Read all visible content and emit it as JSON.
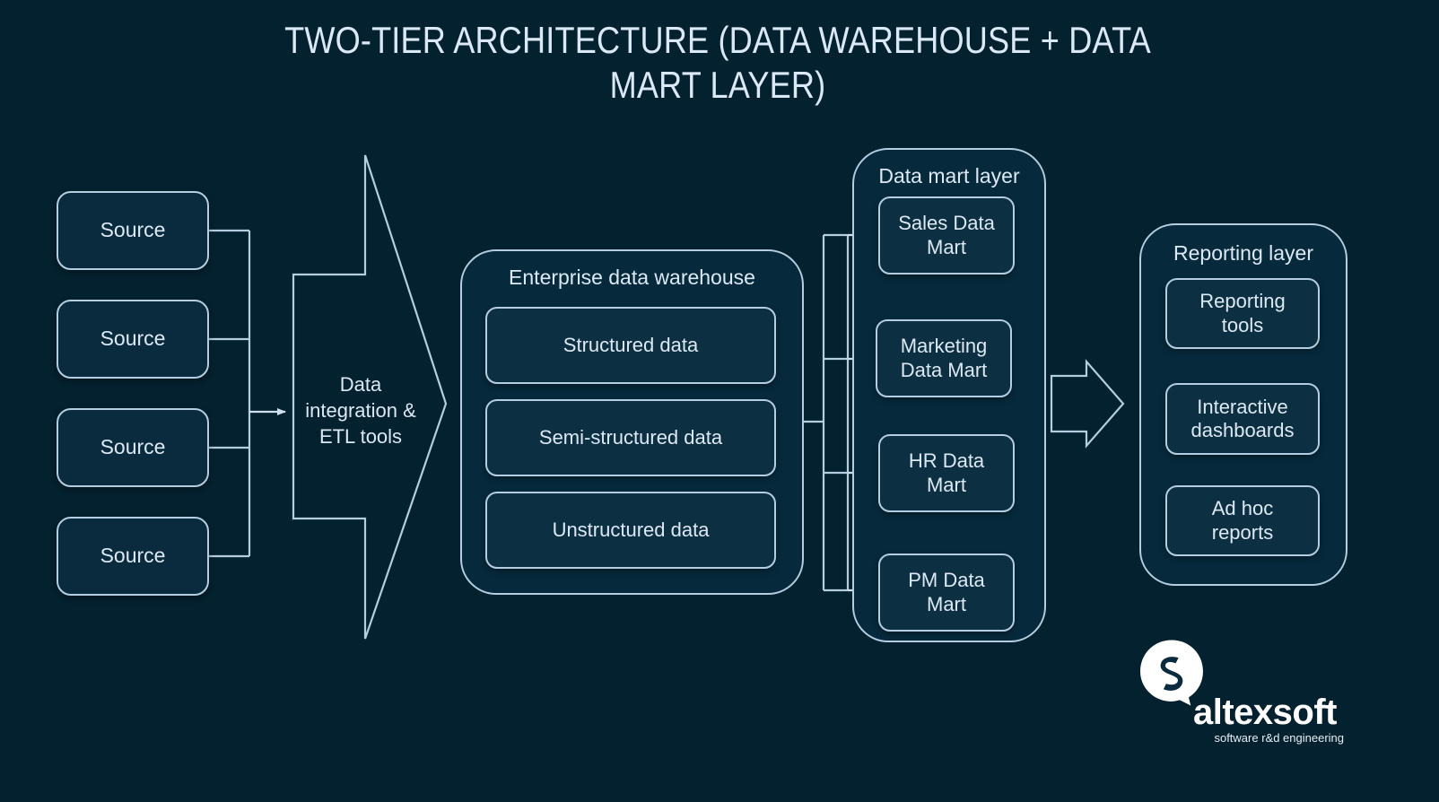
{
  "title": "TWO-TIER ARCHITECTURE (DATA WAREHOUSE + DATA MART LAYER)",
  "colors": {
    "background": "#04212f",
    "box_fill": "#0a2b3d",
    "inner_box_fill": "#0d2f42",
    "container_fill": "#062a3c",
    "stroke": "#b4cde0",
    "text": "#dce9f5",
    "title_text": "#dbe9f7",
    "logo_white": "#ffffff"
  },
  "sources": {
    "items": [
      {
        "label": "Source"
      },
      {
        "label": "Source"
      },
      {
        "label": "Source"
      },
      {
        "label": "Source"
      }
    ]
  },
  "etl": {
    "label": "Data\nintegration &\nETL tools"
  },
  "warehouse": {
    "title": "Enterprise data warehouse",
    "items": [
      {
        "label": "Structured data"
      },
      {
        "label": "Semi-structured data"
      },
      {
        "label": "Unstructured data"
      }
    ]
  },
  "data_mart_layer": {
    "title": "Data mart layer",
    "items": [
      {
        "label": "Sales Data\nMart"
      },
      {
        "label": "Marketing\nData Mart"
      },
      {
        "label": "HR Data\nMart"
      },
      {
        "label": "PM Data\nMart"
      }
    ]
  },
  "reporting_layer": {
    "title": "Reporting layer",
    "items": [
      {
        "label": "Reporting\ntools"
      },
      {
        "label": "Interactive\ndashboards"
      },
      {
        "label": "Ad hoc\nreports"
      }
    ]
  },
  "logo": {
    "name": "altexsoft",
    "tagline": "software r&d engineering"
  }
}
